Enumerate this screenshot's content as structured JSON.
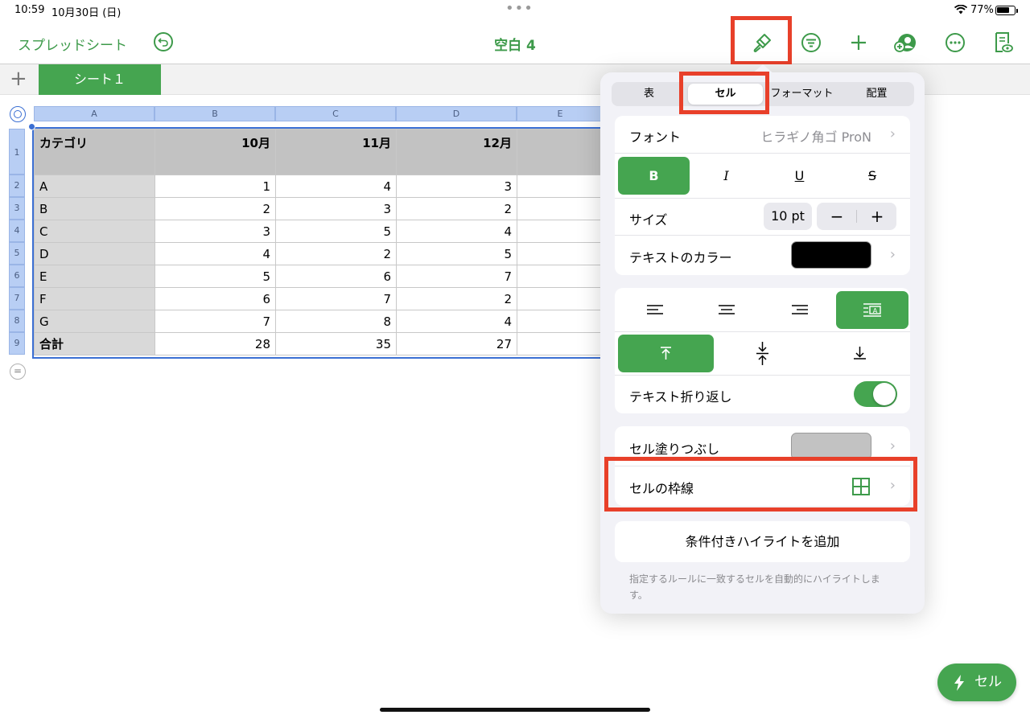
{
  "status": {
    "time": "10:59",
    "date": "10月30日 (日)",
    "battery": "77%",
    "dots": "•••"
  },
  "toolbar": {
    "back_label": "スプレッドシート",
    "title": "空白 4",
    "icons": [
      "undo-icon",
      "paintbrush-icon",
      "filter-icon",
      "plus-icon",
      "collaborate-icon",
      "more-icon",
      "reader-icon"
    ]
  },
  "sheets": {
    "add_label": "+",
    "active_tab": "シート１"
  },
  "table": {
    "columns": [
      "A",
      "B",
      "C",
      "D",
      "E"
    ],
    "row_numbers": [
      "1",
      "2",
      "3",
      "4",
      "5",
      "6",
      "7",
      "8",
      "9"
    ],
    "header": [
      "カテゴリ",
      "10月",
      "11月",
      "12月",
      ""
    ],
    "rows": [
      [
        "A",
        "1",
        "4",
        "3",
        ""
      ],
      [
        "B",
        "2",
        "3",
        "2",
        ""
      ],
      [
        "C",
        "3",
        "5",
        "4",
        ""
      ],
      [
        "D",
        "4",
        "2",
        "5",
        ""
      ],
      [
        "E",
        "5",
        "6",
        "7",
        ""
      ],
      [
        "F",
        "6",
        "7",
        "2",
        ""
      ],
      [
        "G",
        "7",
        "8",
        "4",
        ""
      ],
      [
        "合計",
        "28",
        "35",
        "27",
        ""
      ]
    ]
  },
  "panel": {
    "tabs": [
      "表",
      "セル",
      "フォーマット",
      "配置"
    ],
    "active_tab": "セル",
    "font_label": "フォント",
    "font_value": "ヒラギノ角ゴ ProN",
    "style_buttons": [
      "B",
      "I",
      "U",
      "S"
    ],
    "size_label": "サイズ",
    "size_value": "10 pt",
    "size_minus": "−",
    "size_plus": "+",
    "text_color_label": "テキストのカラー",
    "text_color": "#000000",
    "wrap_label": "テキスト折り返し",
    "wrap_on": true,
    "fill_label": "セル塗りつぶし",
    "fill_color": "#c2c2c2",
    "border_label": "セルの枠線",
    "highlight_button": "条件付きハイライトを追加",
    "highlight_hint": "指定するルールに一致するセルを自動的にハイライトします。"
  },
  "fab_label": "セル",
  "colors": {
    "accent": "#45a550",
    "selection": "#3b6fd3",
    "annotation": "#e8402a"
  }
}
